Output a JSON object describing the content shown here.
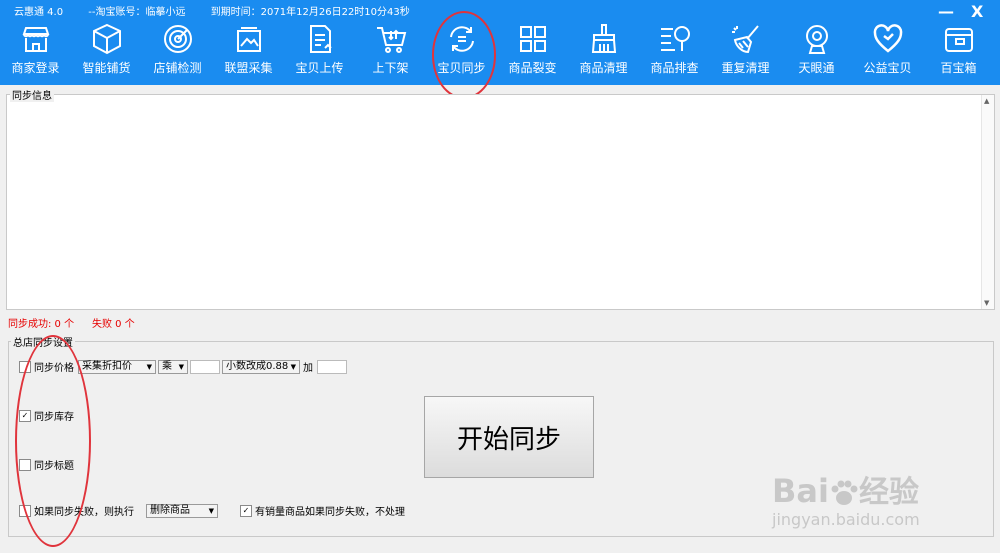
{
  "titlebar": {
    "app": "云惠通  4.0",
    "account": "--淘宝账号：临摹小远",
    "expiry": "到期时间：2071年12月26日22时10分43秒",
    "minimize": "—",
    "close": "X"
  },
  "toolbar": [
    {
      "label": "商家登录",
      "icon": "storefront-icon"
    },
    {
      "label": "智能铺货",
      "icon": "box-icon"
    },
    {
      "label": "店铺检测",
      "icon": "radar-icon"
    },
    {
      "label": "联盟采集",
      "icon": "image-collect-icon"
    },
    {
      "label": "宝贝上传",
      "icon": "document-upload-icon"
    },
    {
      "label": "上下架",
      "icon": "cart-icon"
    },
    {
      "label": "宝贝同步",
      "icon": "sync-icon"
    },
    {
      "label": "商品裂变",
      "icon": "grid-icon"
    },
    {
      "label": "商品清理",
      "icon": "broom-icon"
    },
    {
      "label": "商品排查",
      "icon": "search-list-icon"
    },
    {
      "label": "重复清理",
      "icon": "sweep-icon"
    },
    {
      "label": "天眼通",
      "icon": "webcam-icon"
    },
    {
      "label": "公益宝贝",
      "icon": "heart-icon"
    },
    {
      "label": "百宝箱",
      "icon": "wallet-icon"
    }
  ],
  "sync_info": {
    "label": "同步信息"
  },
  "stats": {
    "success": "同步成功: 0 个",
    "fail": "失败 0 个"
  },
  "settings": {
    "label": "总店同步设置",
    "sync_price": "同步价格",
    "price_source": "采集折扣价",
    "operator": "乘",
    "decimal_option": "小数改成0.88",
    "add_label": "加",
    "sync_stock": "同步库存",
    "sync_title": "同步标题",
    "on_fail": "如果同步失败，则执行",
    "fail_action": "删除商品",
    "skip_sales": "有销量商品如果同步失败，不处理",
    "start_button": "开始同步"
  },
  "checked": {
    "sync_price": false,
    "sync_stock": true,
    "sync_title": false,
    "on_fail": false,
    "skip_sales": true
  },
  "watermark": {
    "brand": "Bai",
    "brand_suffix": "经验",
    "url": "jingyan.baidu.com"
  },
  "colors": {
    "accent": "#1a8cf0",
    "annotation": "#e0343c",
    "stat_text": "#e60000"
  }
}
